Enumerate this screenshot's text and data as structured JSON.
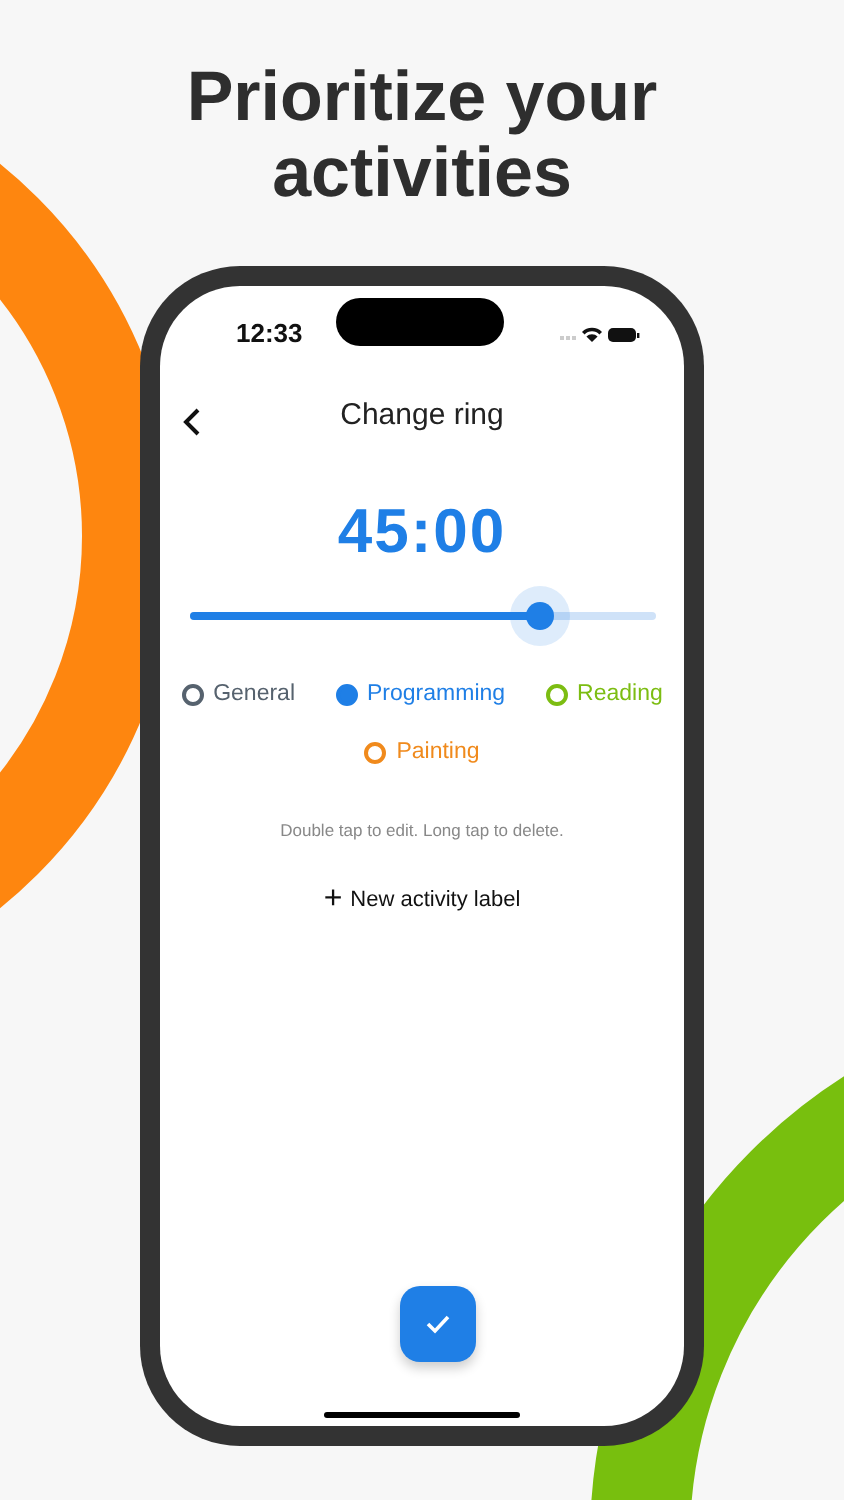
{
  "headline": "Prioritize your activities",
  "status_bar": {
    "time": "12:33"
  },
  "nav": {
    "title": "Change ring"
  },
  "timer": {
    "value": "45:00",
    "level": 0.75
  },
  "labels": [
    {
      "name": "General",
      "color": "#56626e",
      "selected": false
    },
    {
      "name": "Programming",
      "color": "#1f7fe6",
      "selected": true
    },
    {
      "name": "Reading",
      "color": "#7cbd12",
      "selected": false
    },
    {
      "name": "Painting",
      "color": "#f08a1c",
      "selected": false
    }
  ],
  "hint": "Double tap to edit. Long tap to delete.",
  "add_button": {
    "icon": "+",
    "label": "New activity label"
  }
}
